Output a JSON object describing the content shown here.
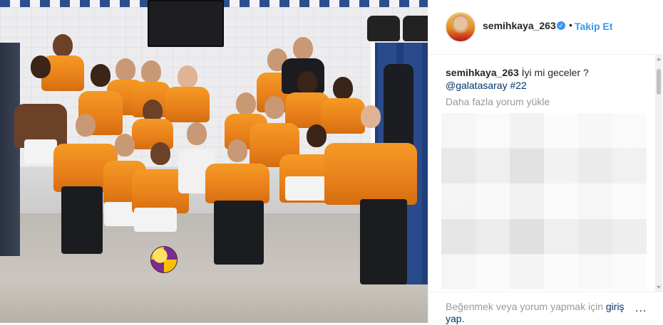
{
  "post": {
    "photo": {
      "alt": ""
    },
    "header": {
      "username": "semihkaya_263",
      "verified_icon": "verified-badge-icon",
      "separator": "•",
      "follow_label": "Takip Et"
    },
    "caption": {
      "username": "semihkaya_263",
      "text": "İyi mi geceler ?",
      "mention": "@galatasaray",
      "hashtag": "#22"
    },
    "load_more_label": "Daha fazla yorum yükle",
    "footer": {
      "login_prompt": "Beğenmek veya yorum yapmak için",
      "login_link": "giriş yap.",
      "more_icon": "ellipsis-icon",
      "more_label": "..."
    },
    "colors": {
      "link_blue": "#3897f0",
      "hashtag_navy": "#003569",
      "muted": "#999999",
      "text": "#262626",
      "jersey_orange": "#f08c1e"
    }
  }
}
